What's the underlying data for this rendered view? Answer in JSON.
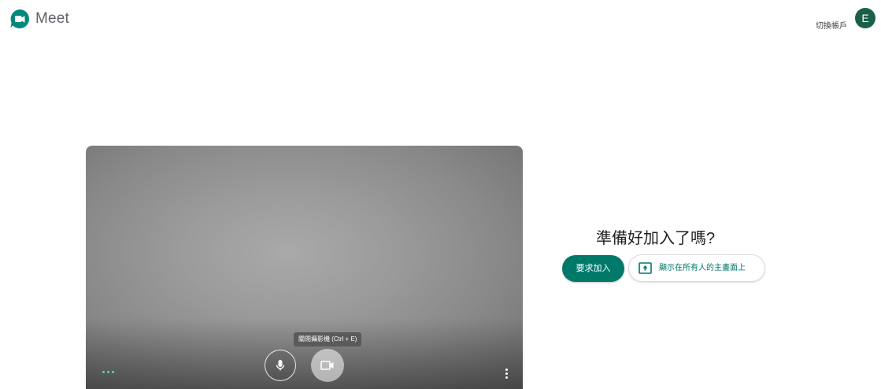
{
  "header": {
    "app_name": "Meet",
    "switch_account_label": "切換帳戶",
    "avatar_letter": "E"
  },
  "preview": {
    "camera_tooltip": "關閉攝影機 (Ctrl + E)"
  },
  "join_panel": {
    "title": "準備好加入了嗎?",
    "join_button_label": "要求加入",
    "present_button_label": "顯示在所有人的主畫面上"
  },
  "colors": {
    "accent": "#00796b",
    "avatar_bg": "#1b5e4b"
  },
  "icons": [
    "meet-logo-icon",
    "microphone-icon",
    "camera-icon",
    "more-options-dots-icon",
    "kebab-menu-icon",
    "present-screen-icon"
  ]
}
